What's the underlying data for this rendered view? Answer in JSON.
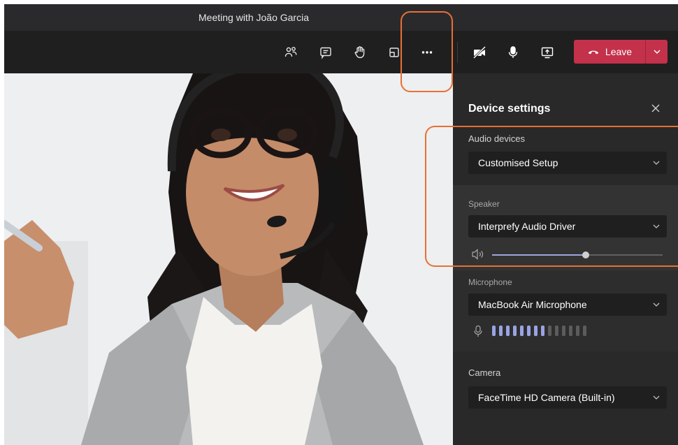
{
  "window": {
    "title": "Meeting with João Garcia"
  },
  "toolbar": {
    "buttons": [
      {
        "icon": "people-icon"
      },
      {
        "icon": "chat-icon"
      },
      {
        "icon": "raise-hand-icon"
      },
      {
        "icon": "rooms-icon"
      },
      {
        "icon": "more-options-icon"
      },
      {
        "icon": "camera-off-icon"
      },
      {
        "icon": "microphone-icon"
      },
      {
        "icon": "share-screen-icon"
      }
    ],
    "leave_label": "Leave",
    "leave_color": "#c4314b"
  },
  "panel": {
    "title": "Device settings",
    "audio_devices": {
      "label": "Audio devices",
      "value": "Customised Setup"
    },
    "speaker": {
      "label": "Speaker",
      "value": "Interprefy Audio Driver",
      "volume": 0.55
    },
    "microphone": {
      "label": "Microphone",
      "value": "MacBook Air Microphone",
      "level_bars_total": 14,
      "level_bars_active": 8
    },
    "camera": {
      "label": "Camera",
      "value": "FaceTime HD Camera (Built-in)"
    }
  },
  "colors": {
    "accent": "#9aa3e2",
    "highlight": "#e87035",
    "panel_bg": "#292929"
  }
}
